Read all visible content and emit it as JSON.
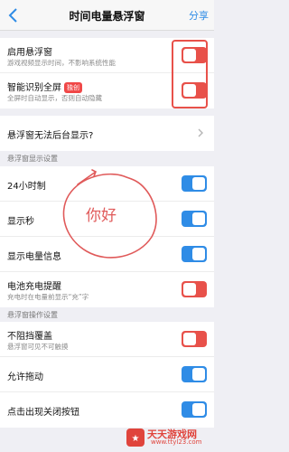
{
  "navbar": {
    "title": "时间电量悬浮窗",
    "share_label": "分享"
  },
  "group1": {
    "enable": {
      "label": "启用悬浮窗",
      "sub": "游戏视频显示时间，不影响系统性能",
      "on": true
    },
    "fullscreen": {
      "label": "智能识别全屏",
      "badge": "独创",
      "sub": "全屏时自动显示，否则自动隐藏",
      "on": true
    }
  },
  "link_row": {
    "label": "悬浮窗无法后台显示?"
  },
  "section_display": {
    "header": "悬浮窗显示设置"
  },
  "display": [
    {
      "label": "24小时制",
      "on": true
    },
    {
      "label": "显示秒",
      "on": true
    },
    {
      "label": "显示电量信息",
      "on": true
    }
  ],
  "charge": {
    "label": "电池充电提醒",
    "sub": "充电时在电量前显示“充”字",
    "on": false
  },
  "section_ops": {
    "header": "悬浮窗操作设置"
  },
  "ops": {
    "nonblock": {
      "label": "不阻挡覆盖",
      "sub": "悬浮窗可见不可触摸",
      "on": false
    },
    "drag": {
      "label": "允许拖动",
      "on": true
    },
    "closebtn": {
      "label": "点击出现关闭按钮",
      "on": true
    }
  },
  "handwriting": {
    "text": "你好"
  },
  "watermark": {
    "main": "天天游戏网",
    "sub": "www.ttyl23.com"
  },
  "colors": {
    "accent_blue": "#2f8ce6",
    "accent_red": "#e8514a"
  }
}
